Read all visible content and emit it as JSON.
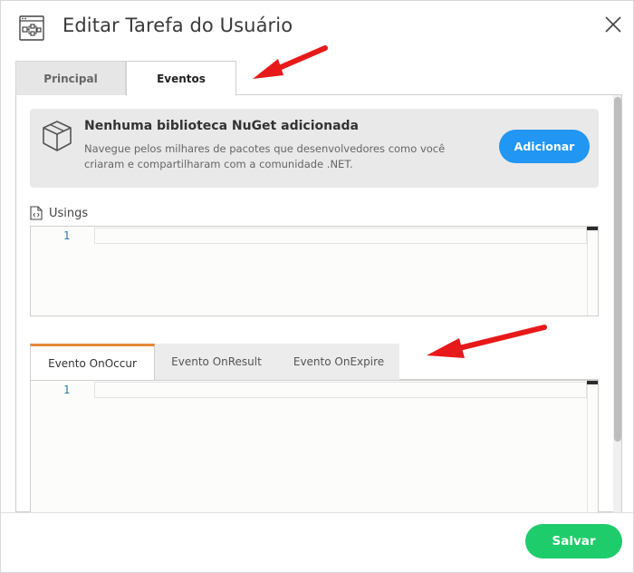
{
  "dialog": {
    "title": "Editar Tarefa do Usuário",
    "close_icon": "close-icon",
    "app_icon": "workflow-diagram-icon"
  },
  "top_tabs": [
    {
      "label": "Principal",
      "active": false
    },
    {
      "label": "Eventos",
      "active": true
    }
  ],
  "nuget": {
    "icon": "package-box-icon",
    "title": "Nenhuma biblioteca NuGet adicionada",
    "description": "Navegue pelos milhares de pacotes que desenvolvedores como você criaram e compartilharam com a comunidade .NET.",
    "add_label": "Adicionar"
  },
  "usings": {
    "label": "Usings",
    "icon": "code-file-icon",
    "line_number": "1"
  },
  "event_tabs": [
    {
      "label": "Evento OnOccur",
      "active": true
    },
    {
      "label": "Evento OnResult",
      "active": false
    },
    {
      "label": "Evento OnExpire",
      "active": false
    }
  ],
  "event_editor": {
    "line_number": "1"
  },
  "footer": {
    "save_label": "Salvar"
  },
  "colors": {
    "accent_blue": "#2196f3",
    "save_green": "#1fcc6b",
    "active_tab_accent": "#e8883a",
    "annotation_arrow": "#e8191a",
    "line_number": "#2b7aa5"
  }
}
